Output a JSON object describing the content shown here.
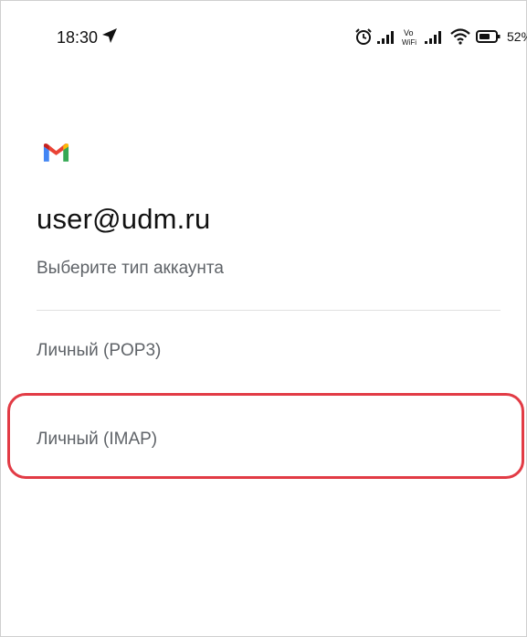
{
  "status_bar": {
    "time": "18:30",
    "battery_percent": "52%",
    "icons": [
      "location-arrow-icon",
      "alarm-icon",
      "signal-icon",
      "vowifi-icon",
      "signal-icon",
      "wifi-icon",
      "battery-icon"
    ],
    "vowifi_top": "Vo",
    "vowifi_bottom": "WiFi"
  },
  "account": {
    "logo": "gmail-icon",
    "email": "user@udm.ru",
    "prompt": "Выберите тип аккаунта"
  },
  "options": [
    {
      "label": "Личный (POP3)"
    },
    {
      "label": "Личный (IMAP)",
      "highlighted": true
    }
  ],
  "colors": {
    "highlight": "#e23b45",
    "gmail_red": "#ea4335",
    "gmail_blue": "#4285f4",
    "gmail_green": "#34a853",
    "gmail_yellow": "#fbbc04"
  }
}
